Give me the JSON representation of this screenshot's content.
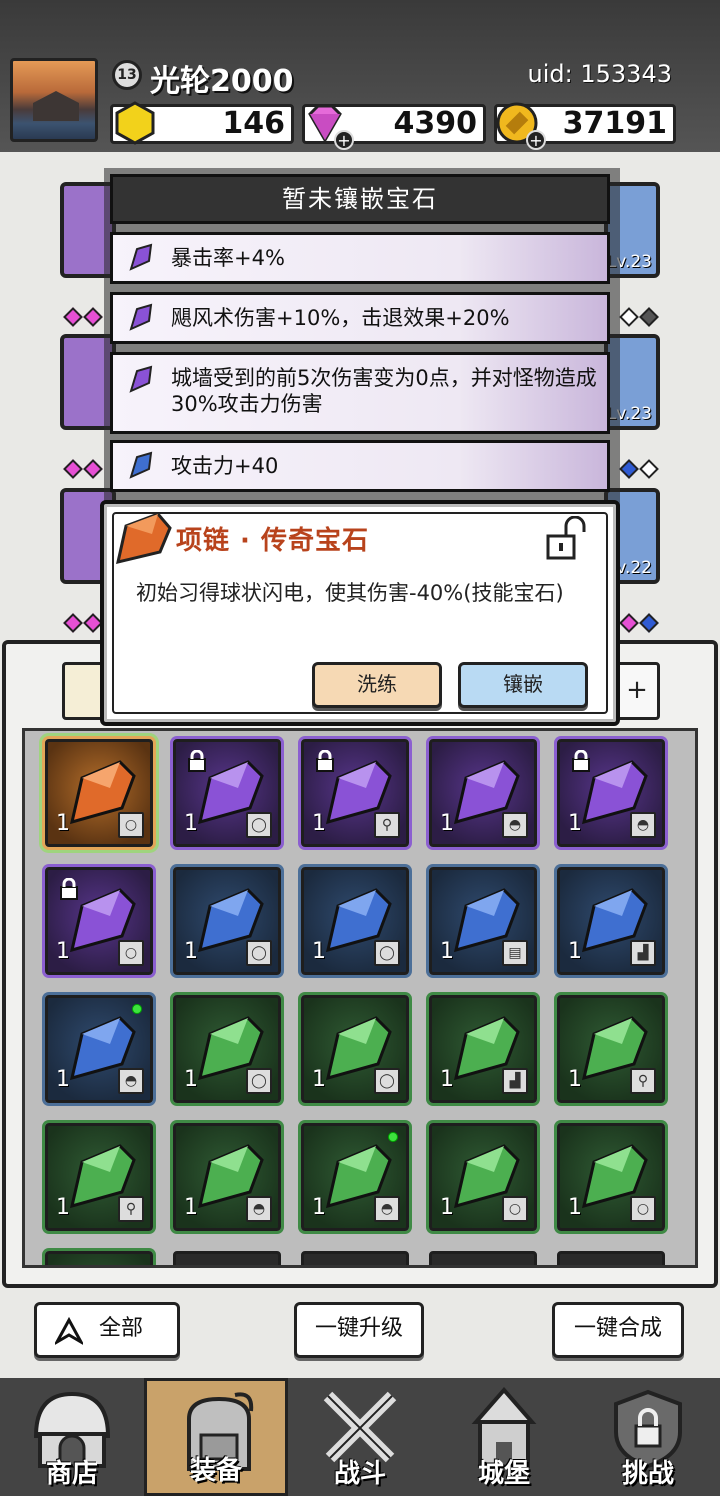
{
  "player": {
    "level": "13",
    "name": "光轮2000",
    "uid": "uid: 153343"
  },
  "resources": {
    "stamina": "146",
    "diamonds": "4390",
    "gold": "37191"
  },
  "equipment_levels": [
    "Lv.23",
    "Lv.23",
    "Lv.22"
  ],
  "gem_slots": {
    "title": "暂未镶嵌宝石",
    "effects": [
      {
        "text": "暴击率+4%",
        "gem_color": "purple"
      },
      {
        "text": "飓风术伤害+10%，击退效果+20%",
        "gem_color": "purple"
      },
      {
        "text": "城墙受到的前5次伤害变为0点，并对怪物造成30%攻击力伤害",
        "gem_color": "purple"
      },
      {
        "text": "攻击力+40",
        "gem_color": "blue"
      }
    ]
  },
  "popup": {
    "title": "项链 · 传奇宝石",
    "description": "初始习得球状闪电，使其伤害-40%(技能宝石)",
    "refine_label": "洗练",
    "inlay_label": "镶嵌"
  },
  "inventory": {
    "tab_add": "+",
    "items": [
      {
        "color": "orange",
        "count": "1",
        "type": "necklace-icon",
        "locked": false,
        "new": false
      },
      {
        "color": "purple",
        "count": "1",
        "type": "ring-icon",
        "locked": true,
        "new": false
      },
      {
        "color": "purple",
        "count": "1",
        "type": "wand-icon",
        "locked": true,
        "new": false
      },
      {
        "color": "purple",
        "count": "1",
        "type": "helmet-icon",
        "locked": false,
        "new": false
      },
      {
        "color": "purple",
        "count": "1",
        "type": "helmet-icon",
        "locked": true,
        "new": false
      },
      {
        "color": "purple",
        "count": "1",
        "type": "necklace-icon",
        "locked": true,
        "new": false
      },
      {
        "color": "blue",
        "count": "1",
        "type": "ring-icon",
        "locked": false,
        "new": false
      },
      {
        "color": "blue",
        "count": "1",
        "type": "ring-icon",
        "locked": false,
        "new": false
      },
      {
        "color": "blue",
        "count": "1",
        "type": "armor-icon",
        "locked": false,
        "new": false
      },
      {
        "color": "blue",
        "count": "1",
        "type": "boots-icon",
        "locked": false,
        "new": false
      },
      {
        "color": "blue",
        "count": "1",
        "type": "helmet-icon",
        "locked": false,
        "new": true
      },
      {
        "color": "green",
        "count": "1",
        "type": "ring-icon",
        "locked": false,
        "new": false
      },
      {
        "color": "green",
        "count": "1",
        "type": "ring-icon",
        "locked": false,
        "new": false
      },
      {
        "color": "green",
        "count": "1",
        "type": "boots-icon",
        "locked": false,
        "new": false
      },
      {
        "color": "green",
        "count": "1",
        "type": "wand-icon",
        "locked": false,
        "new": false
      },
      {
        "color": "green",
        "count": "1",
        "type": "wand-icon",
        "locked": false,
        "new": false
      },
      {
        "color": "green",
        "count": "1",
        "type": "helmet-icon",
        "locked": false,
        "new": false
      },
      {
        "color": "green",
        "count": "1",
        "type": "helmet-icon",
        "locked": false,
        "new": true
      },
      {
        "color": "green",
        "count": "1",
        "type": "necklace-icon",
        "locked": false,
        "new": false
      },
      {
        "color": "green",
        "count": "1",
        "type": "necklace-icon",
        "locked": false,
        "new": false
      }
    ]
  },
  "actions": {
    "filter_all": "全部",
    "upgrade_all": "一键升级",
    "merge_all": "一键合成"
  },
  "nav": {
    "shop": "商店",
    "equipment": "装备",
    "battle": "战斗",
    "castle": "城堡",
    "challenge": "挑战"
  },
  "colors": {
    "purple_gem": "#8a52d6",
    "blue_gem": "#3f6fd0",
    "green_gem": "#4caf50",
    "orange_gem": "#e06a2a",
    "popup_title": "#b8431c"
  }
}
